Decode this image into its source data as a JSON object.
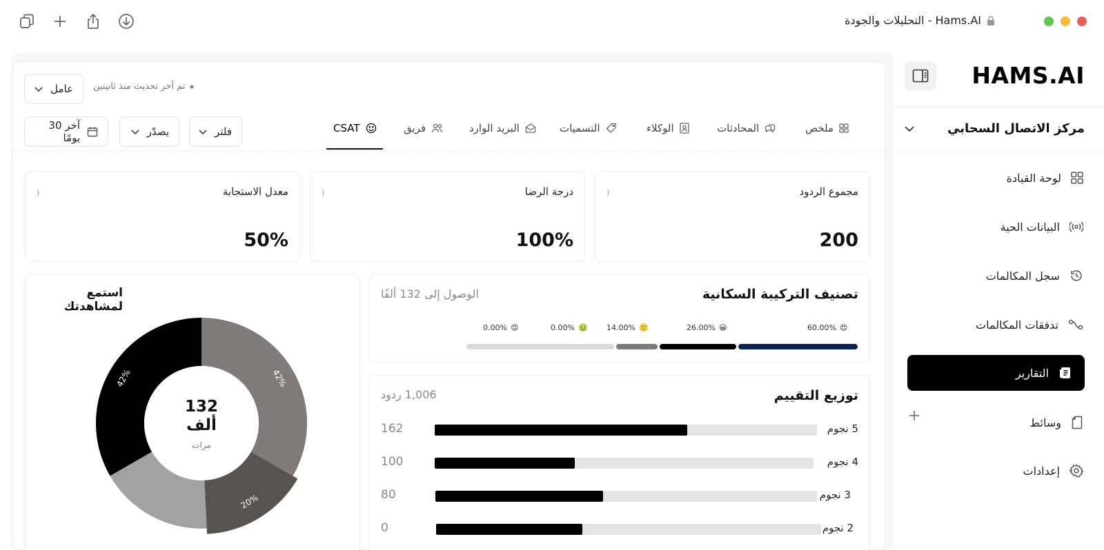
{
  "window": {
    "title": "التحليلات والجودة - Hams.AI"
  },
  "sidebar": {
    "brand": "HAMS.AI",
    "org": "مركز الاتصال السحابي",
    "items": [
      {
        "label": "لوحة القيادة",
        "icon": "grid-icon"
      },
      {
        "label": "البيانات الحية",
        "icon": "broadcast-icon"
      },
      {
        "label": "سجل المكالمات",
        "icon": "history-icon"
      },
      {
        "label": "تدفقات المكالمات",
        "icon": "flow-icon"
      },
      {
        "label": "التقارير",
        "icon": "report-icon",
        "active": true
      },
      {
        "label": "وسائط",
        "icon": "media-icon"
      },
      {
        "label": "إعدادات",
        "icon": "gear-icon"
      }
    ]
  },
  "toolbar": {
    "agent_select": "عامل",
    "updated": "تم آخر تحديث منذ ثانيتين",
    "date_range": "آخر 30 يومًا",
    "export": "يصدّر",
    "filter": "فلتر"
  },
  "tabs": [
    {
      "label": "ملخص",
      "icon": "grid-icon"
    },
    {
      "label": "المحادثات",
      "icon": "chat-icon"
    },
    {
      "label": "الوكلاء",
      "icon": "agent-icon"
    },
    {
      "label": "التسميات",
      "icon": "tag-icon"
    },
    {
      "label": "البريد الوارد",
      "icon": "inbox-icon"
    },
    {
      "label": "فريق",
      "icon": "team-icon"
    },
    {
      "label": "CSAT",
      "icon": "smile-icon",
      "active": true
    }
  ],
  "stats": [
    {
      "label": "مجموع الردود",
      "value": "200"
    },
    {
      "label": "درجة الرضا",
      "value": "100%"
    },
    {
      "label": "معدل الاستجابة",
      "value": "50%"
    }
  ],
  "sentiment": {
    "title": "تصنيف التركيبة السكانية",
    "subtitle": "الوصول إلى 132 ألفًا",
    "items": [
      {
        "pct": "60.00%",
        "emoji": "😍",
        "share": 0.3,
        "color": "#0b2350"
      },
      {
        "pct": "26.00%",
        "emoji": "😀",
        "share": 0.2,
        "color": "#000000"
      },
      {
        "pct": "14.00%",
        "emoji": "🙂",
        "share": 0.1,
        "color": "#7a7a7a"
      },
      {
        "pct": "0.00%",
        "emoji": "🤢",
        "share": 0.0,
        "color": "#d9d9d9"
      },
      {
        "pct": "0.00%",
        "emoji": "😡",
        "share": 0.0,
        "color": "#d9d9d9"
      }
    ]
  },
  "ratings": {
    "title": "توزيع التقييم",
    "total": "1,006 ردود",
    "rows": [
      {
        "label": "5 نجوم",
        "count": "162",
        "fraction": 0.66
      },
      {
        "label": "4 نجوم",
        "count": "100",
        "fraction": 0.37
      },
      {
        "label": "3 نجوم",
        "count": "80",
        "fraction": 0.44
      },
      {
        "label": "2 نجوم",
        "count": "0",
        "fraction": 0.38
      }
    ]
  },
  "audience": {
    "title": "استمع لمشاهدتك",
    "center_value": "132 ألف",
    "center_sub": "مرات"
  },
  "chart_data": {
    "type": "pie",
    "title": "استمع لمشاهدتك",
    "slices": [
      {
        "label": "42%",
        "value": 42,
        "color": "#7f7b7b",
        "show_label": true
      },
      {
        "label": "20%",
        "value": 20,
        "color": "#57534f",
        "show_label": true
      },
      {
        "label": "",
        "value": 22,
        "color": "#a2a2a2",
        "show_label": false
      },
      {
        "label": "42%",
        "value": 42,
        "color": "#000000",
        "show_label": true
      }
    ]
  }
}
